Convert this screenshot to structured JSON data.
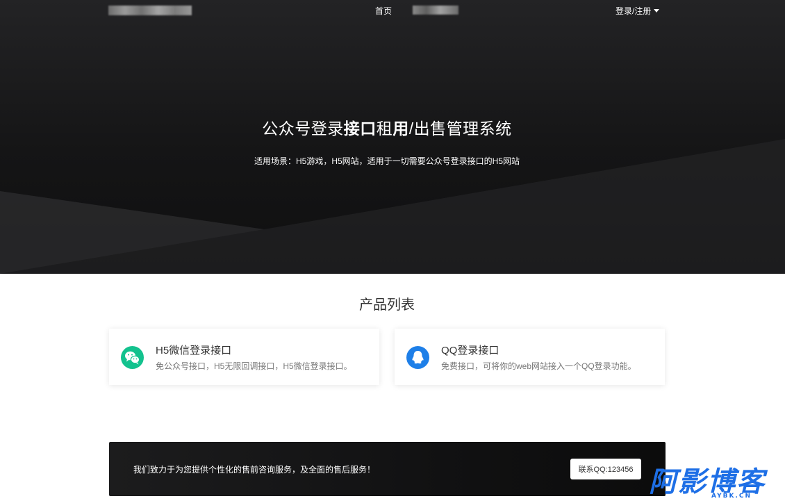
{
  "nav": {
    "home_label": "首页",
    "login_label": "登录/注册"
  },
  "hero": {
    "title_part1": "公众号登录",
    "title_bold1": "接口",
    "title_part2": "租",
    "title_bold2": "用",
    "title_part3": "/出售管理系统",
    "subtitle": "适用场景：H5游戏，H5网站，适用于一切需要公众号登录接口的H5网站"
  },
  "products": {
    "title": "产品列表",
    "items": [
      {
        "title": "H5微信登录接口",
        "desc": "免公众号接口，H5无限回调接口，H5微信登录接口。",
        "icon": "wechat-icon",
        "color": "#13c28e"
      },
      {
        "title": "QQ登录接口",
        "desc": "免费接口，可将你的web网站接入一个QQ登录功能。",
        "icon": "qq-icon",
        "color": "#1e7fe8"
      }
    ]
  },
  "banner": {
    "text": "我们致力于为您提供个性化的售前咨询服务，及全面的售后服务！",
    "button_label": "联系QQ:123456"
  },
  "watermark": {
    "main": "阿影博客",
    "sub": "AYBK.CN"
  }
}
